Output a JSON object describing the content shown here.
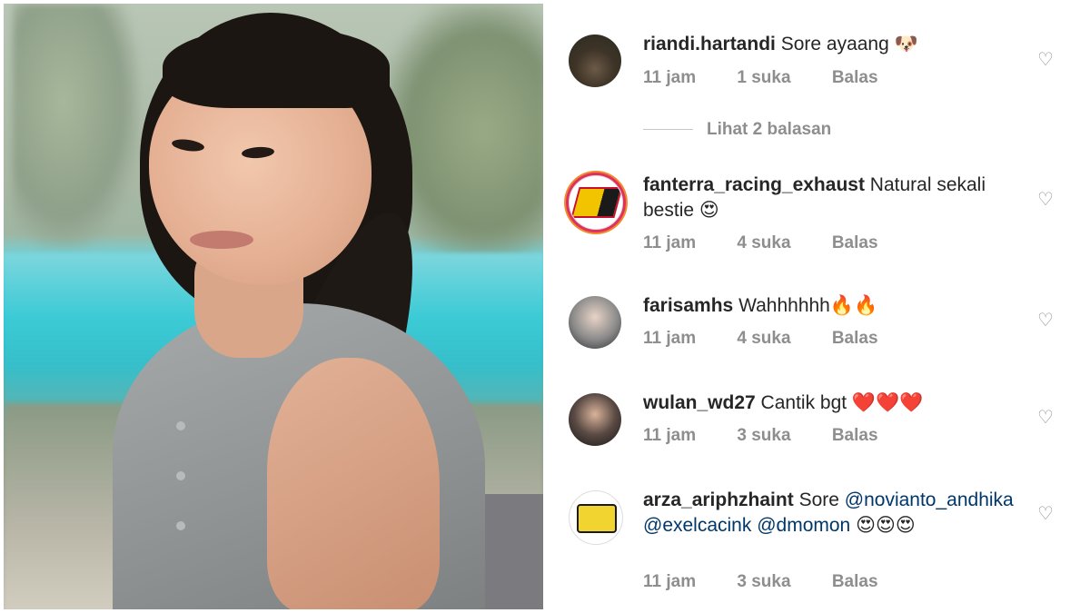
{
  "comments": [
    {
      "username": "riandi.hartandi",
      "text": "Sore ayaang 🐶",
      "time": "11 jam",
      "likes": "1 suka",
      "reply": "Balas",
      "view_replies": "Lihat 2 balasan"
    },
    {
      "username": "fanterra_racing_exhaust",
      "text": "Natural sekali bestie 😍",
      "time": "11 jam",
      "likes": "4 suka",
      "reply": "Balas"
    },
    {
      "username": "farisamhs",
      "text": "Wahhhhhh🔥🔥",
      "time": "11 jam",
      "likes": "4 suka",
      "reply": "Balas"
    },
    {
      "username": "wulan_wd27",
      "text": "Cantik bgt ❤️❤️❤️",
      "time": "11 jam",
      "likes": "3 suka",
      "reply": "Balas"
    },
    {
      "username": "arza_ariphzhaint",
      "text_before": "Sore ",
      "mention_1": "@novianto_andhika",
      "mention_2": "@exelcacink",
      "mention_3": "@dmomon",
      "text_after": "😍😍😍",
      "time": "11 jam",
      "likes": "3 suka",
      "reply": "Balas"
    }
  ],
  "icons": {
    "like": "heart-outline-icon"
  },
  "colors": {
    "username": "#262626",
    "meta": "#8e8e8e",
    "mention": "#00376b"
  }
}
